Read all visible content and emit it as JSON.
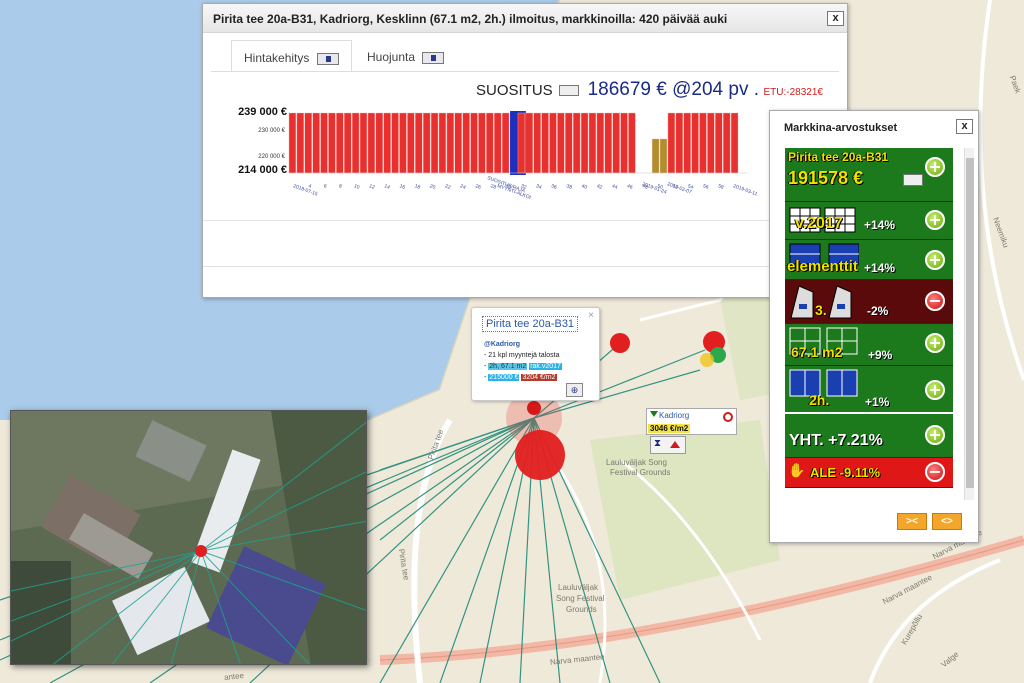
{
  "listing": {
    "title": "Pirita tee 20a-B31, Kadriorg, Kesklinn (67.1 m2, 2h.) ilmoitus, markkinoilla: 420 päivää auki",
    "close": "x",
    "tabs": [
      {
        "label": "Hintakehitys",
        "active": true
      },
      {
        "label": "Huojunta",
        "active": false
      }
    ],
    "recommendation": {
      "label": "SUOSITUS",
      "value": "186679 € @204 pv .",
      "advantage": "ETU:-28321€"
    }
  },
  "chart_data": {
    "type": "bar",
    "ylim": [
      214000,
      239000
    ],
    "y_ticks_major": [
      "239 000 €",
      "214 000 €"
    ],
    "y_ticks_minor": [
      "230 000 €",
      "220 000 €"
    ],
    "x_tick_labels": [
      "2018-07-15",
      "4",
      "6",
      "8",
      "10",
      "12",
      "14",
      "16",
      "18",
      "20",
      "22",
      "24",
      "26",
      "28",
      "30",
      "32",
      "34",
      "36",
      "38",
      "40",
      "42",
      "44",
      "46",
      "48",
      "50",
      "52",
      "54",
      "56",
      "58",
      "2019-03-11"
    ],
    "annotations": [
      "SUOSITUS/RAJA",
      "MYYNTI-ALKOI",
      "2019-01-24",
      "2019-02-07"
    ],
    "series": [
      {
        "values_summary": "red bars at 239000 (asking price)",
        "color": "#e8302f"
      },
      {
        "values_summary": "blue recommendation marker at 239000",
        "color": "#1e2fc0"
      },
      {
        "values_summary": "gold bars ~225000",
        "color": "#b08e2a"
      }
    ]
  },
  "popup": {
    "title": "Pirita tee 20a-B31",
    "close": "×",
    "area": "@Kadriorg",
    "line1": "- 21 kpl myyntejä talosta",
    "line2a": "2h, 67.1 m2",
    "line2b": "rak.v2017",
    "line3a": "215000 €",
    "line3b": "3204 €/m2"
  },
  "kadriorg_label": {
    "name": "Kadriorg",
    "value": "3046 €/m2"
  },
  "market": {
    "title": "Markkina-arvostukset",
    "close": "x",
    "header_name": "Pirita tee 20a-B31",
    "header_price": "191578 €",
    "rows": [
      {
        "label": "v.2017",
        "pct": "+14%",
        "type": "plus"
      },
      {
        "label": "elementtit",
        "pct": "+14%",
        "type": "plus"
      },
      {
        "label": "3.",
        "pct": "-2%",
        "type": "minus"
      },
      {
        "label": "67.1 m2",
        "pct": "+9%",
        "type": "plus"
      },
      {
        "label": "2h.",
        "pct": "+1%",
        "type": "plus"
      }
    ],
    "total": "YHT. +7.21%",
    "discount": "ALE -9.11%",
    "nav_left": "><",
    "nav_right": "<>"
  },
  "map_labels": {
    "song_festival_1": "Lauluväljak Song",
    "song_festival_2": "Festival Grounds",
    "song_festival_3": "Lauluväljak",
    "song_festival_4": "Song Festival",
    "song_festival_5": "Grounds",
    "pirita_tee_1": "Pirita tee",
    "pirita_tee_2": "Pirita tee",
    "narva_1": "Narva maantee",
    "narva_2": "Narva maantee",
    "narva_3": "Narva maantee",
    "kurepolli": "Kurepõllu",
    "valge": "Valge",
    "neemiku": "Neemiku",
    "paeka": "Paek",
    "mantee": "antee"
  }
}
